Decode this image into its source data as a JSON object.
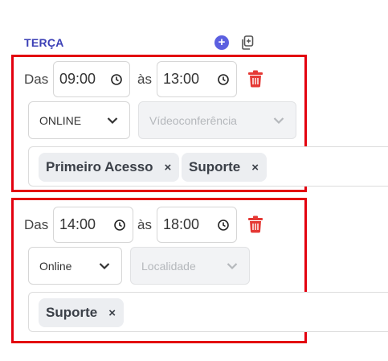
{
  "day": {
    "title": "TERÇA"
  },
  "icons": {
    "add": "plus-circle-icon",
    "copy": "copy-icon",
    "clock": "clock-icon",
    "trash": "trash-icon",
    "chevron": "chevron-down-icon"
  },
  "colors": {
    "title": "#3b3fb6",
    "add_button": "#5b5fe0",
    "highlight": "#e3000f",
    "trash": "#e53935"
  },
  "slots": [
    {
      "from_label": "Das",
      "from": "09:00",
      "to_label": "às",
      "to": "13:00",
      "mode": "ONLINE",
      "location_placeholder": "Vídeoconferência",
      "tags": [
        "Primeiro Acesso",
        "Suporte"
      ]
    },
    {
      "from_label": "Das",
      "from": "14:00",
      "to_label": "às",
      "to": "18:00",
      "mode": "Online",
      "location_placeholder": "Localidade",
      "tags": [
        "Suporte"
      ]
    }
  ],
  "tag_remove_glyph": "×"
}
